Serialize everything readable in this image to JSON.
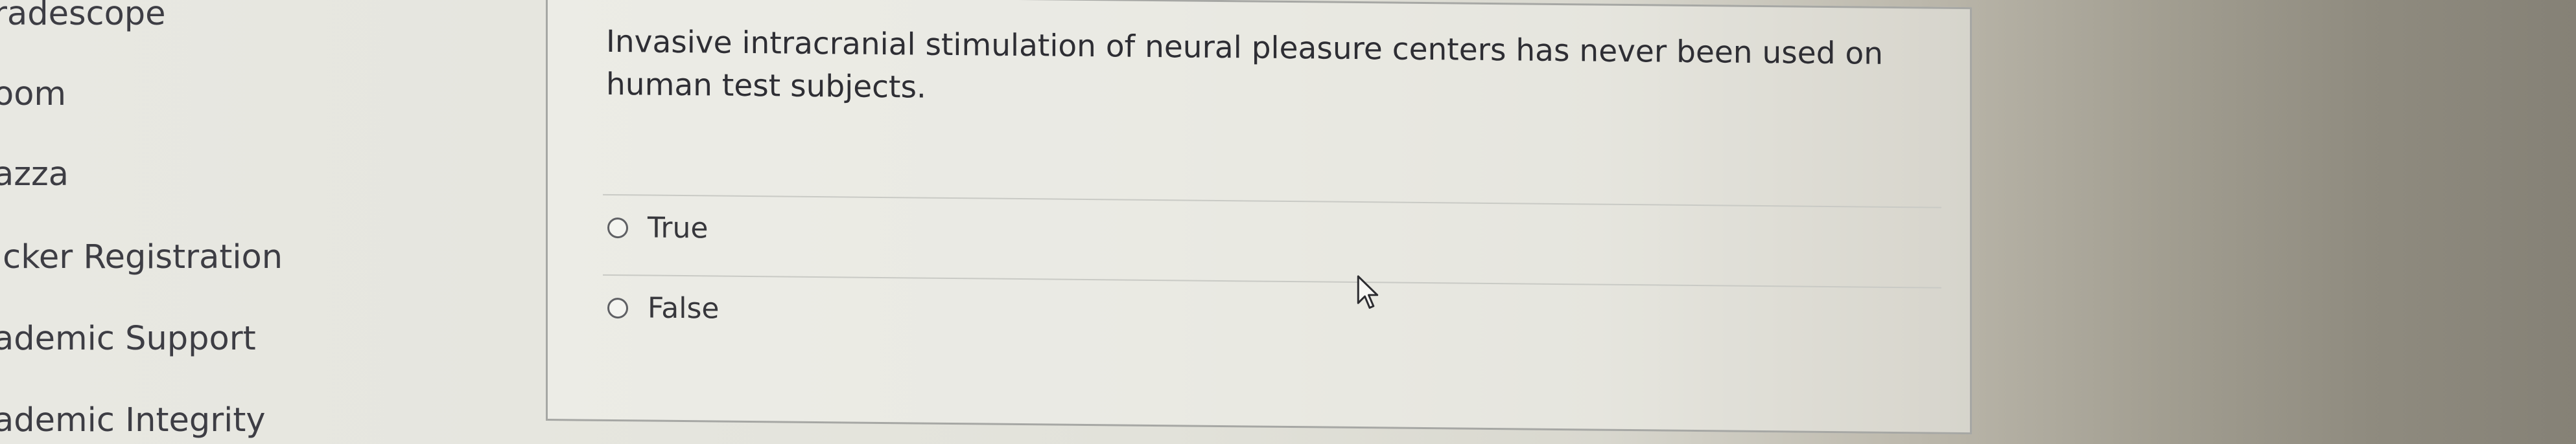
{
  "sidebar": {
    "items": [
      {
        "label": "radescope"
      },
      {
        "label": "oom"
      },
      {
        "label": "azza"
      },
      {
        "label": "icker Registration"
      },
      {
        "label": "ademic Support"
      },
      {
        "label": "ademic Integrity"
      }
    ]
  },
  "question": {
    "text": "Invasive intracranial stimulation of neural pleasure centers has never been used on human test subjects.",
    "options": [
      {
        "label": "True",
        "selected": false
      },
      {
        "label": "False",
        "selected": false
      }
    ]
  },
  "icons": {
    "cursor": "mouse-pointer-arrow",
    "radio": "radio-unchecked"
  },
  "colors": {
    "text": "#2e2e34",
    "panel_border": "#a6a7a4",
    "divider": "#c9cac5"
  }
}
